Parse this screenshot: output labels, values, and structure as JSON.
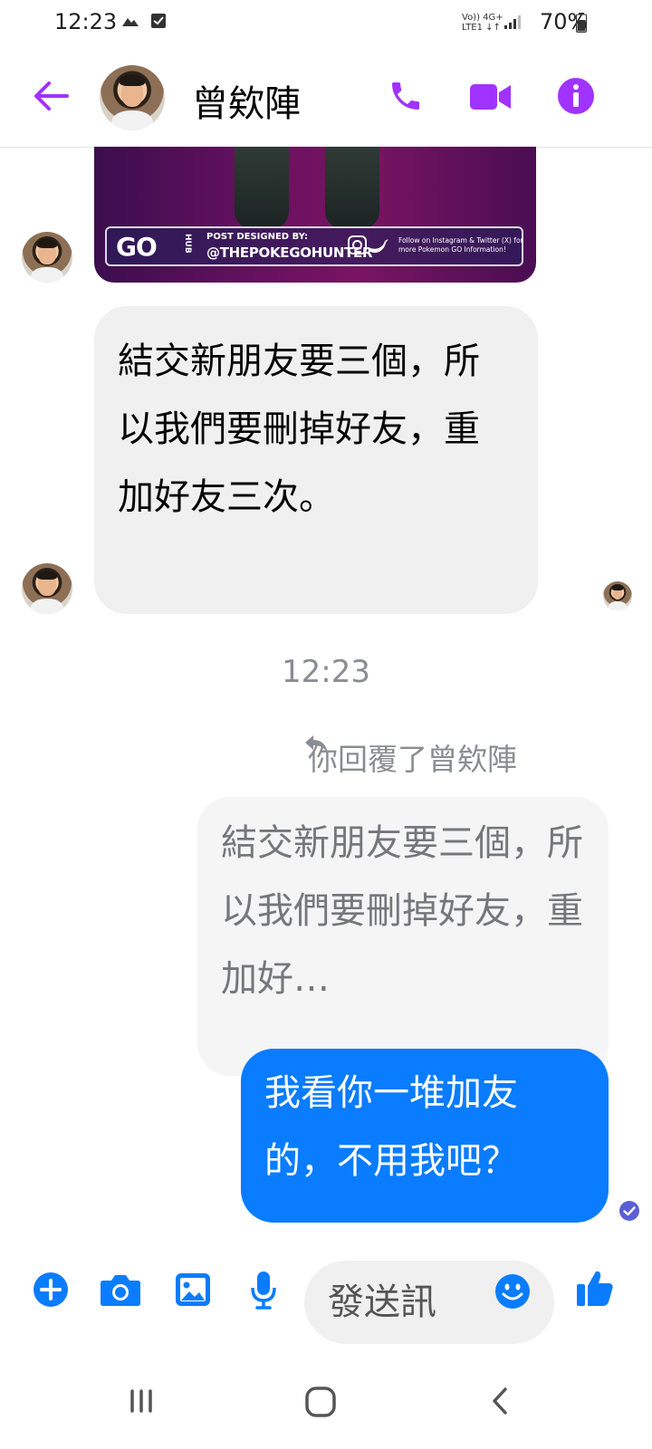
{
  "status_bar": {
    "time": "12:23",
    "network_top": "Vo)) 4G+",
    "network_bottom": "LTE1 ↓↑",
    "battery": "70%"
  },
  "header": {
    "contact_name": "曾欸陣",
    "icons": [
      "back-arrow-icon",
      "phone-icon",
      "video-call-icon",
      "info-icon"
    ],
    "accent_color": "#a033ff"
  },
  "shared_image": {
    "logo": "GO",
    "hub": "HUB",
    "posted_by": "POST DESIGNED BY:",
    "handle": "@THEPOKEGOHUNTER",
    "follow_text": "Follow on Instagram & Twitter (X) for more Pokemon GO Information!"
  },
  "messages": {
    "received_text": "結交新朋友要三個，所以我們要刪掉好友，重加好友三次。",
    "time_divider": "12:23",
    "reply_label": "你回覆了曾欸陣",
    "reply_quote": "結交新朋友要三個，所以我們要刪掉好友，重加好…",
    "sent_text": "我看你一堆加友的，不用我吧？",
    "sent_color": "#0a7cff"
  },
  "composer": {
    "input_value": "發送訊",
    "icons": [
      "plus-icon",
      "camera-icon",
      "gallery-icon",
      "microphone-icon",
      "emoji-icon",
      "thumbs-up-icon"
    ],
    "accent_color": "#0a7cff"
  },
  "nav_bar": {
    "icons": [
      "recent-apps-icon",
      "home-icon",
      "back-icon"
    ]
  }
}
